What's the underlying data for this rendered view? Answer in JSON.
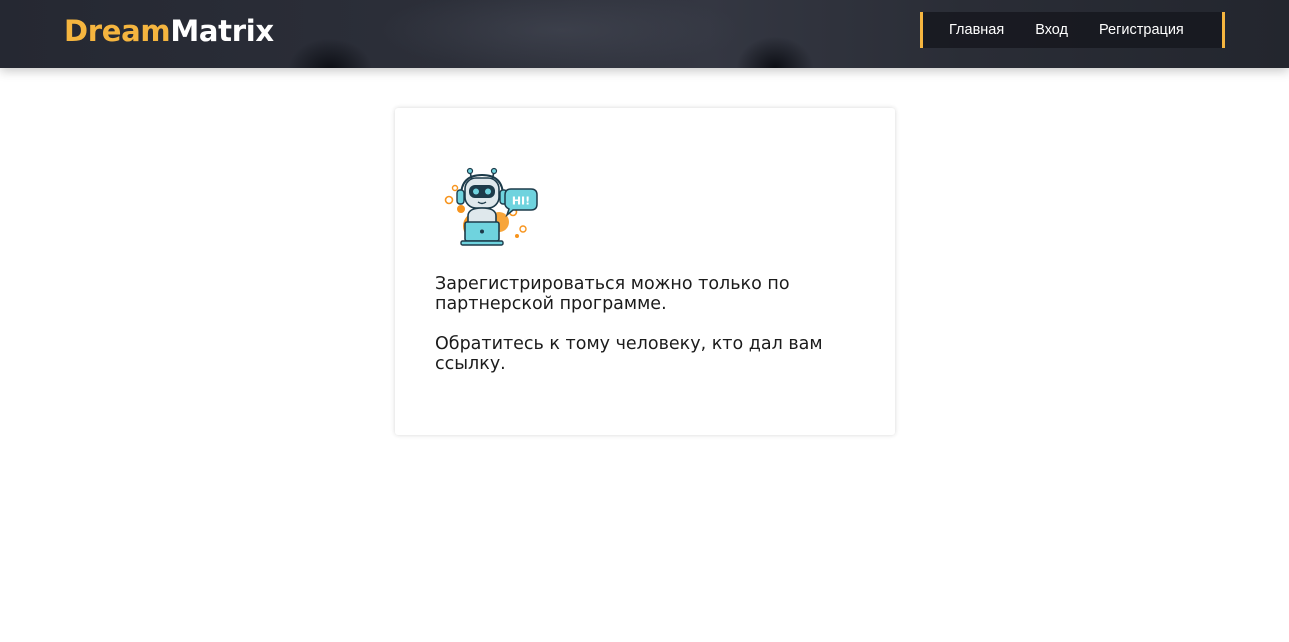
{
  "header": {
    "logo": {
      "part_a": "Dream",
      "part_b": "Matrix"
    },
    "nav": {
      "home": "Главная",
      "login": "Вход",
      "register": "Регистрация"
    },
    "accent_color": "#f5b53f"
  },
  "card": {
    "illustration": "robot-hi-icon",
    "bubble_text": "HI!",
    "line1": "Зарегистрироваться можно только по партнерской программе.",
    "line2": "Обратитесь к тому человеку, кто дал вам ссылку."
  }
}
